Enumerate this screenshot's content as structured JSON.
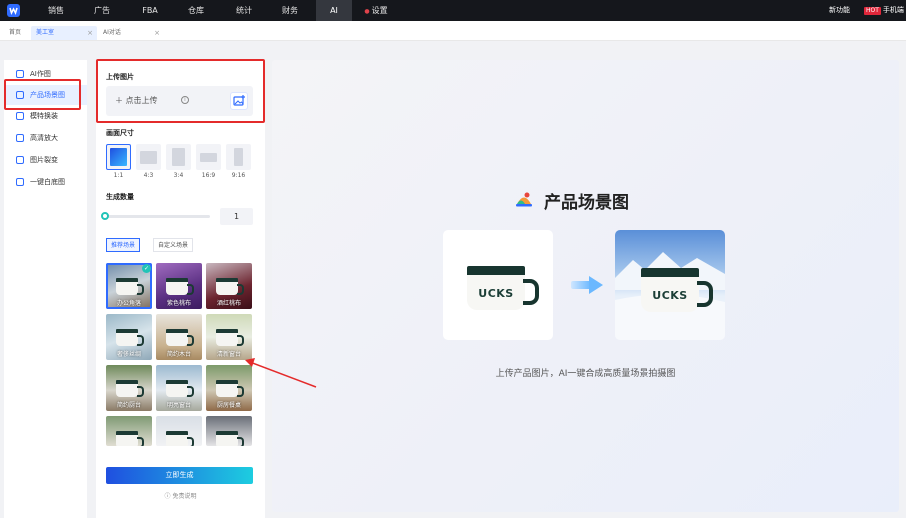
{
  "nav": {
    "items": [
      "销售",
      "广告",
      "FBA",
      "仓库",
      "统计",
      "财务",
      "AI"
    ],
    "settings": "设置",
    "right_new": "新功能",
    "hot_badge": "HOT",
    "right_mobile": "手机端",
    "active_index": 6
  },
  "tabs": {
    "home": "首页",
    "items": [
      {
        "label": "美工室",
        "active": true
      },
      {
        "label": "AI对话",
        "active": false
      }
    ],
    "close_glyph": "×"
  },
  "menu": {
    "items": [
      {
        "label": "AI作图",
        "icon": "magic-wand-icon",
        "active": false
      },
      {
        "label": "产品场景图",
        "icon": "image-icon",
        "active": true
      },
      {
        "label": "模特换装",
        "icon": "person-icon",
        "active": false
      },
      {
        "label": "高清放大",
        "icon": "enlarge-icon",
        "active": false
      },
      {
        "label": "图片裂变",
        "icon": "split-icon",
        "active": false
      },
      {
        "label": "一键白底图",
        "icon": "white-bg-icon",
        "active": false
      }
    ]
  },
  "panel": {
    "upload_title": "上传图片",
    "upload_label": "＋ 点击上传",
    "upload_info_glyph": "i",
    "size_title": "画面尺寸",
    "ratios": [
      "1:1",
      "4:3",
      "3:4",
      "16:9",
      "9:16"
    ],
    "ratio_selected": 0,
    "count_title": "生成数量",
    "count_value": "1",
    "count_fraction": 0.0,
    "scene_tabs": [
      "推荐场景",
      "自定义场景"
    ],
    "scene_tab_selected": 0,
    "scenes": [
      "办公角落",
      "紫色桃布",
      "酒红桃布",
      "奢侈丝绸",
      "简约木台",
      "清新窗台",
      "简约厨台",
      "明亮窗台",
      "厨房餐桌",
      "",
      "",
      ""
    ],
    "scene_selected": 0,
    "generate_label": "立即生成",
    "disclaimer": "ⓘ 免责说明"
  },
  "preview": {
    "title": "产品场景图",
    "mug_text": "UCKS",
    "caption": "上传产品图片，AI一键合成高质量场景拍摄图"
  },
  "colors": {
    "accent": "#2f6bff",
    "annotation": "#e42b2b",
    "nav_bg": "#15171c"
  }
}
